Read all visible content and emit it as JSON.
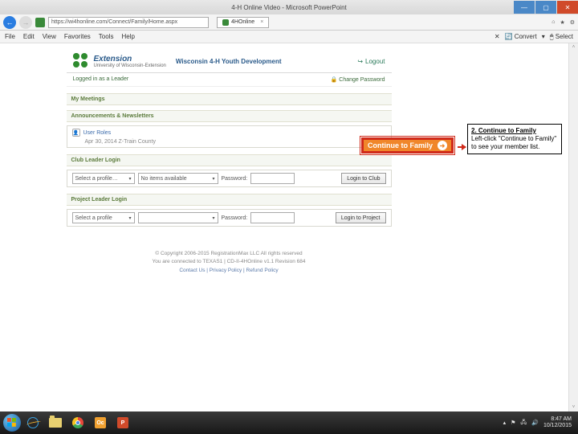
{
  "window": {
    "title": "4-H Online Video - Microsoft PowerPoint"
  },
  "browser": {
    "address": "https://wi4honline.com/Connect/Family/Home.aspx",
    "tab": "4HOnline",
    "menu": [
      "File",
      "Edit",
      "View",
      "Favorites",
      "Tools",
      "Help"
    ],
    "right_tools": {
      "convert": "Convert",
      "select": "Select"
    }
  },
  "header": {
    "logo_main": "Extension",
    "logo_sub": "University of Wisconsin-Extension",
    "site_title": "Wisconsin 4-H Youth Development",
    "logout": "Logout"
  },
  "infobar": {
    "logged_in": "Logged in as a Leader",
    "change_pw": "Change Password"
  },
  "sections": {
    "my_meetings": "My Meetings",
    "announcements": "Announcements & Newsletters",
    "user_roles": "User Roles",
    "user_roles_date": "Apr 30, 2014 Z-Train County",
    "club_login": "Club Leader Login",
    "project_login": "Project Leader Login"
  },
  "continue_btn": "Continue to Family",
  "club_row": {
    "select_profile": "Select a profile…",
    "no_items": "No items available",
    "pw_label": "Password:",
    "login_btn": "Login to Club"
  },
  "project_row": {
    "select_profile": "Select a profile",
    "pw_label": "Password:",
    "login_btn": "Login to Project"
  },
  "callout": {
    "title": "2. Continue to Family",
    "body": "Left-click \"Continue to Family\" to see your member list."
  },
  "footer": {
    "copyright": "© Copyright 2006-2015 RegistrationMax LLC All rights reserved",
    "note": "You are connected to TEXAS1 | CD-II-4HOnline v1.1 Revision 684",
    "links": "Contact Us  |  Privacy Policy  |  Refund Policy"
  },
  "taskbar": {
    "time": "8:47 AM",
    "date": "10/12/2015",
    "oc": "Oc",
    "pp": "P"
  }
}
